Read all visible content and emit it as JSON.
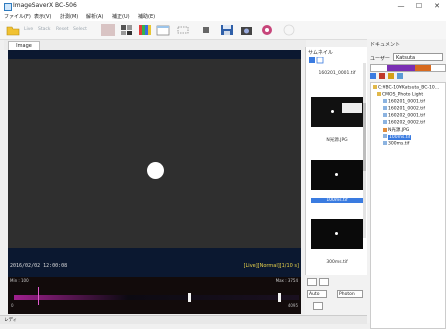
{
  "window": {
    "title": "ImageSaverX BC-506",
    "minimize": "—",
    "maximize": "☐",
    "close": "✕"
  },
  "menu": [
    "ファイル(F)",
    "表示(V)",
    "計測(M)",
    "解析(A)",
    "補正(U)",
    "補助(E)"
  ],
  "toolbar": {
    "labels": [
      "Live",
      "Stack",
      "Reset",
      "Select"
    ]
  },
  "tabs": {
    "image": "Image"
  },
  "image": {
    "timestamp": "2016/02/02 12:00:08",
    "overlay": "[Live][Normal][1/10 s]"
  },
  "histogram": {
    "min_label": "Min : 100",
    "max_label": "Max : 3754",
    "low_value": "0",
    "high_value": "4095"
  },
  "thumbs": {
    "title": "サムネイル",
    "items": [
      {
        "label": "160201_0001.tif",
        "selected": false
      },
      {
        "label": "N光源.JPG",
        "selected": false
      },
      {
        "label": "100ms.tif",
        "selected": true
      },
      {
        "label": "300ms.tif",
        "selected": false
      }
    ]
  },
  "controls": {
    "auto": "Auto",
    "photon": "Photon"
  },
  "documents": {
    "title": "ドキュメント",
    "user_label": "ユーザー",
    "user_value": "Katsuta",
    "tree": [
      {
        "label": "C:¥BC-10¥Katsuta_BC-10…",
        "level": 0
      },
      {
        "label": "CMOS_Photo Light",
        "level": 1
      },
      {
        "label": "160201_0001.tif",
        "level": 2
      },
      {
        "label": "160201_0002.tif",
        "level": 2
      },
      {
        "label": "160202_0001.tif",
        "level": 2
      },
      {
        "label": "160202_0002.tif",
        "level": 2
      },
      {
        "label": "N光源.JPG",
        "level": 2
      },
      {
        "label": "100ms.tif",
        "level": 2,
        "selected": true
      },
      {
        "label": "300ms.tif",
        "level": 2
      }
    ]
  },
  "status": {
    "text": "レディ"
  },
  "colors": {
    "accent": "#3a7be0",
    "image_bg": "#0b1830",
    "frame": "#2f2f2f",
    "overlay": "#e8d24a"
  }
}
